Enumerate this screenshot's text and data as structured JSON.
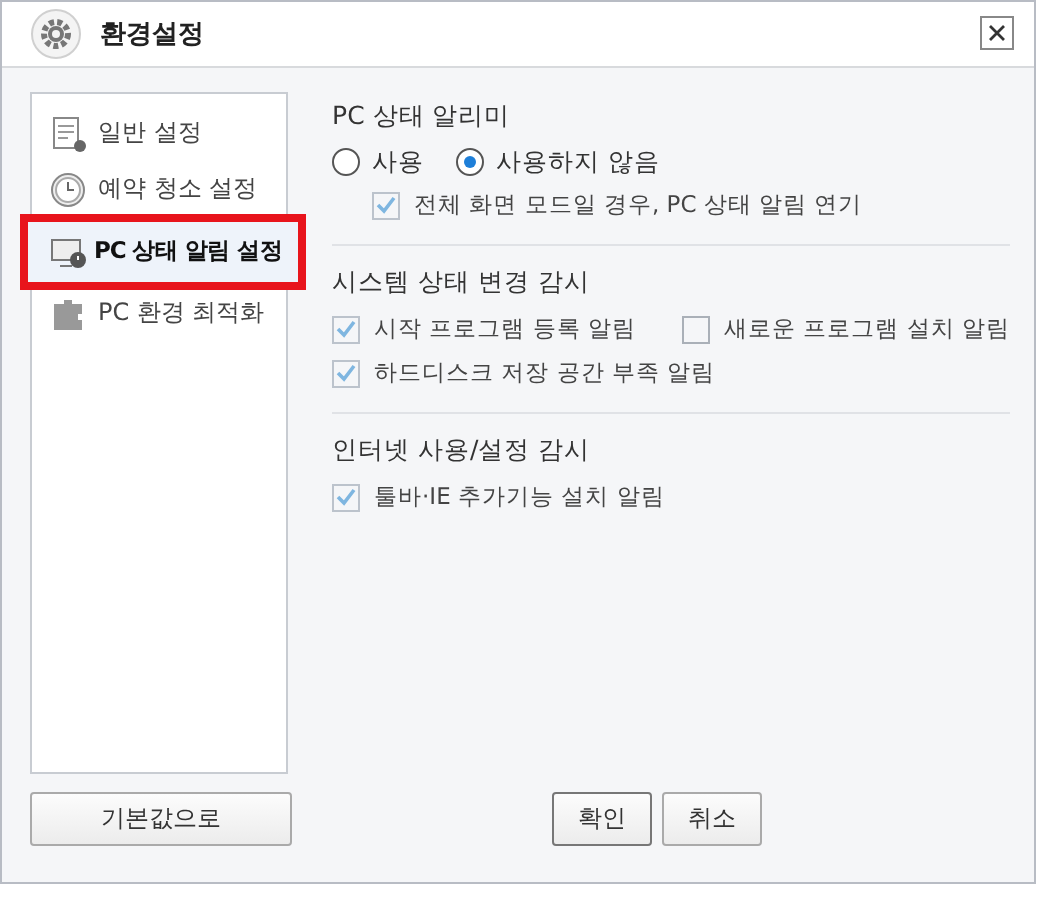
{
  "window": {
    "title": "환경설정"
  },
  "sidebar": {
    "items": [
      {
        "label": "일반 설정",
        "selected": false
      },
      {
        "label": "예약 청소 설정",
        "selected": false
      },
      {
        "label": "PC 상태 알림 설정",
        "selected": true
      },
      {
        "label": "PC 환경 최적화",
        "selected": false
      }
    ]
  },
  "sections": [
    {
      "title": "PC 상태 알리미",
      "radios": [
        {
          "label": "사용",
          "selected": false
        },
        {
          "label": "사용하지 않음",
          "selected": true
        }
      ],
      "sub_options": [
        {
          "label": "전체 화면 모드일 경우, PC 상태 알림 연기",
          "checked": true
        }
      ]
    },
    {
      "title": "시스템 상태 변경 감시",
      "options": [
        {
          "label": "시작 프로그램 등록 알림",
          "checked": true
        },
        {
          "label": "새로운 프로그램 설치 알림",
          "checked": false
        },
        {
          "label": "하드디스크 저장 공간 부족 알림",
          "checked": true
        }
      ]
    },
    {
      "title": "인터넷 사용/설정 감시",
      "options": [
        {
          "label": "툴바·IE 추가기능 설치 알림",
          "checked": true
        }
      ]
    }
  ],
  "buttons": {
    "reset": "기본값으로",
    "ok": "확인",
    "cancel": "취소"
  }
}
